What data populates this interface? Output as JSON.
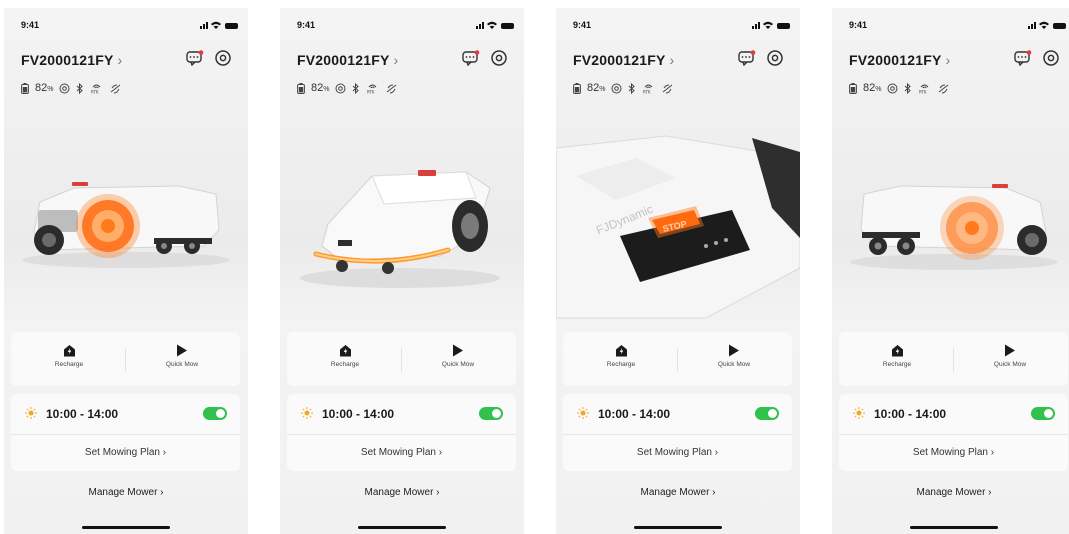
{
  "screens": [
    {
      "status": {
        "time": "9:41"
      },
      "device": {
        "name": "FV2000121FY",
        "chevron": "›"
      },
      "info": {
        "battery_value": "82",
        "battery_unit": "%"
      },
      "actions": [
        {
          "label": "Recharge",
          "icon": "home-charge-icon"
        },
        {
          "label": "Quick Mow",
          "icon": "play-icon"
        }
      ],
      "plan": {
        "time_range": "10:00 - 14:00",
        "enabled": true,
        "set_label": "Set Mowing Plan ›"
      },
      "manage_label": "Manage Mower ›",
      "image": "mower-side-view"
    },
    {
      "status": {
        "time": "9:41"
      },
      "device": {
        "name": "FV2000121FY",
        "chevron": "›"
      },
      "info": {
        "battery_value": "82",
        "battery_unit": "%"
      },
      "actions": [
        {
          "label": "Recharge",
          "icon": "home-charge-icon"
        },
        {
          "label": "Quick Mow",
          "icon": "play-icon"
        }
      ],
      "plan": {
        "time_range": "10:00 - 14:00",
        "enabled": true,
        "set_label": "Set Mowing Plan ›"
      },
      "manage_label": "Manage Mower ›",
      "image": "mower-front-view"
    },
    {
      "status": {
        "time": "9:41"
      },
      "device": {
        "name": "FV2000121FY",
        "chevron": "›"
      },
      "info": {
        "battery_value": "82",
        "battery_unit": "%"
      },
      "actions": [
        {
          "label": "Recharge",
          "icon": "home-charge-icon"
        },
        {
          "label": "Quick Mow",
          "icon": "play-icon"
        }
      ],
      "plan": {
        "time_range": "10:00 - 14:00",
        "enabled": true,
        "set_label": "Set Mowing Plan ›"
      },
      "manage_label": "Manage Mower ›",
      "image": "mower-top-closeup",
      "brand_text": "FJDynamic",
      "stop_text": "STOP"
    },
    {
      "status": {
        "time": "9:41"
      },
      "device": {
        "name": "FV2000121FY",
        "chevron": "›"
      },
      "info": {
        "battery_value": "82",
        "battery_unit": "%"
      },
      "actions": [
        {
          "label": "Recharge",
          "icon": "home-charge-icon"
        },
        {
          "label": "Quick Mow",
          "icon": "play-icon"
        }
      ],
      "plan": {
        "time_range": "10:00 - 14:00",
        "enabled": true,
        "set_label": "Set Mowing Plan ›"
      },
      "manage_label": "Manage Mower ›",
      "image": "mower-side-view-mirrored"
    }
  ],
  "colors": {
    "toggle_on": "#31c24d",
    "wheel_glow": "#ff7a1a",
    "sun": "#f5a623"
  }
}
